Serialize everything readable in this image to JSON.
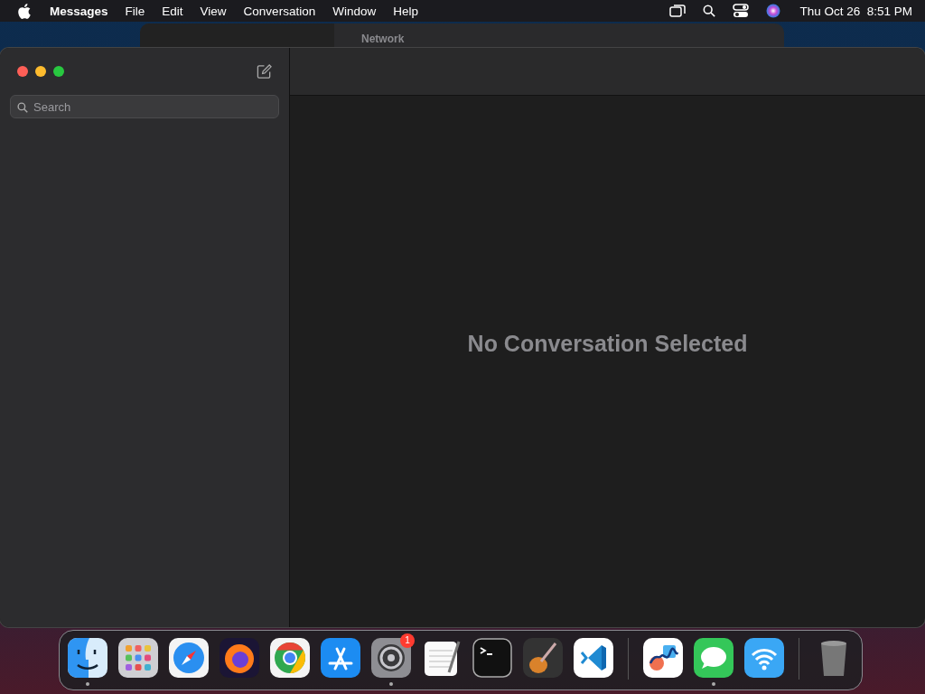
{
  "menu_bar": {
    "app_name": "Messages",
    "menus": [
      "File",
      "Edit",
      "View",
      "Conversation",
      "Window",
      "Help"
    ],
    "clock": "Thu Oct 26  8:51 PM"
  },
  "background_window": {
    "title": "Network"
  },
  "sidebar": {
    "search": {
      "placeholder": "Search"
    }
  },
  "main": {
    "empty_message": "No Conversation Selected"
  },
  "dock": {
    "sections": [
      [
        {
          "running": true
        },
        {
          "running": false
        },
        {
          "running": false
        },
        {
          "running": false
        },
        {
          "running": false
        },
        {
          "running": false
        },
        {
          "running": true,
          "badge": "1"
        },
        {
          "running": false
        },
        {
          "running": false
        },
        {
          "running": false
        },
        {
          "running": false
        }
      ],
      [
        {
          "running": false
        },
        {
          "running": true
        },
        {
          "running": false
        }
      ],
      [
        {
          "running": false
        }
      ]
    ]
  }
}
